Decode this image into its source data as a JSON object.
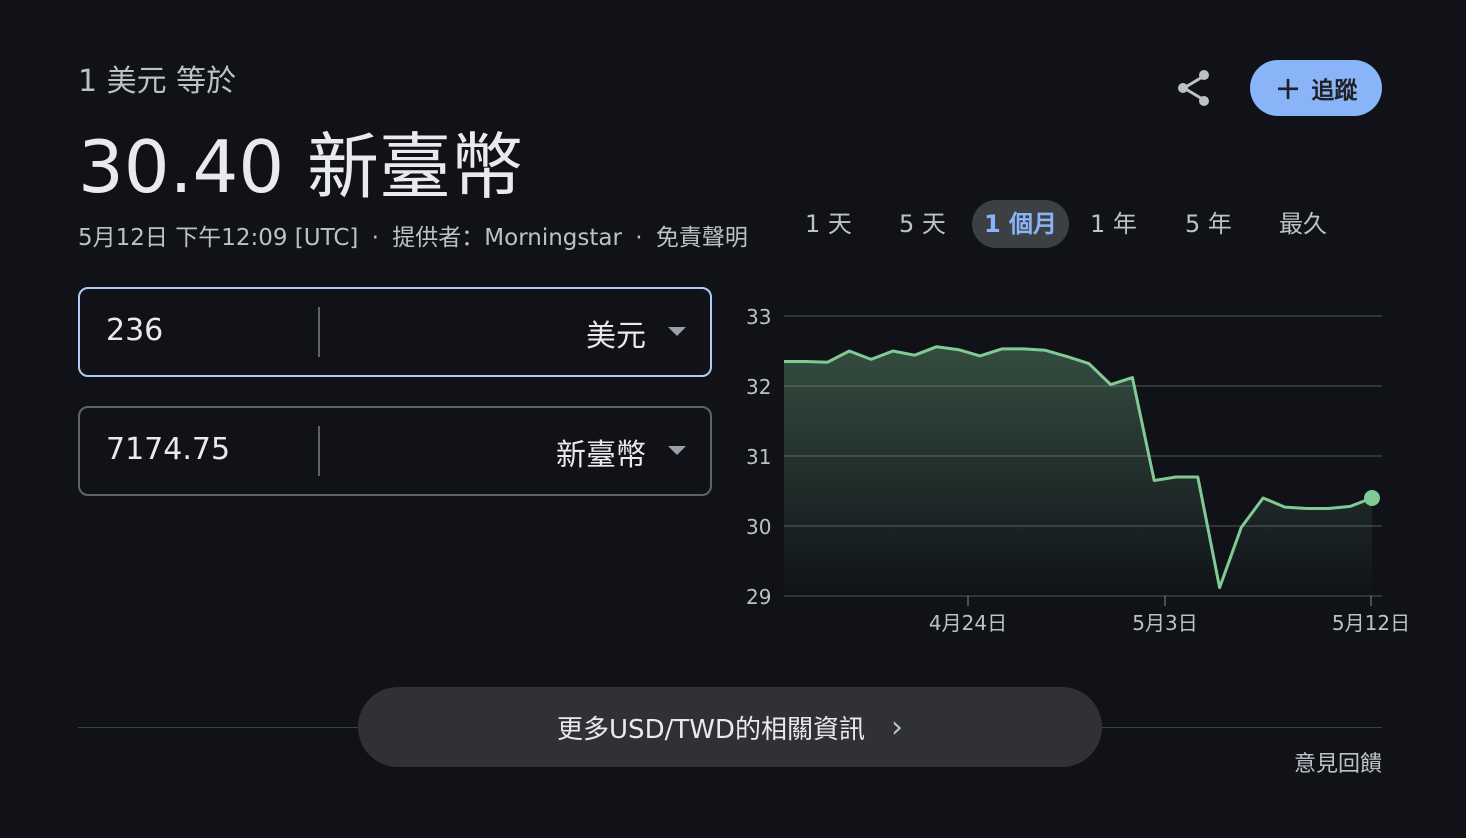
{
  "header": {
    "subtitle": "1 美元 等於",
    "headline": "30.40 新臺幣",
    "timestamp": "5月12日 下午12:09 [UTC]",
    "separator": "·",
    "provider": "提供者：Morningstar",
    "disclaimer": "免責聲明"
  },
  "actions": {
    "share_icon": "share-icon",
    "follow_label": "追蹤",
    "follow_icon": "+"
  },
  "converter": {
    "from": {
      "value": "236",
      "currency": "美元"
    },
    "to": {
      "value": "7174.75",
      "currency": "新臺幣"
    }
  },
  "range_tabs": {
    "items": [
      "1 天",
      "5 天",
      "1 個月",
      "1 年",
      "5 年",
      "最久"
    ],
    "active": "1 個月"
  },
  "colors": {
    "line": "#81c995",
    "accent": "#8ab4f8",
    "background": "#101218"
  },
  "chart_data": {
    "type": "area",
    "title": "",
    "xlabel": "",
    "ylabel": "",
    "ylim": [
      29,
      33
    ],
    "y_ticks": [
      "33",
      "32",
      "31",
      "30",
      "29"
    ],
    "x_ticks": [
      "4月24日",
      "5月3日",
      "5月12日"
    ],
    "grid": true,
    "series": [
      {
        "values": [
          32.35,
          32.35,
          32.34,
          32.5,
          32.38,
          32.5,
          32.44,
          32.56,
          32.52,
          32.43,
          32.53,
          32.53,
          32.51,
          32.42,
          32.32,
          32.02,
          32.12,
          30.65,
          30.7,
          30.7,
          29.12,
          29.98,
          30.4,
          30.27,
          30.25,
          30.25,
          30.28,
          30.4
        ]
      }
    ]
  },
  "footer": {
    "more_label": "更多USD/TWD的相關資訊",
    "more_chevron": "›",
    "feedback": "意見回饋"
  }
}
